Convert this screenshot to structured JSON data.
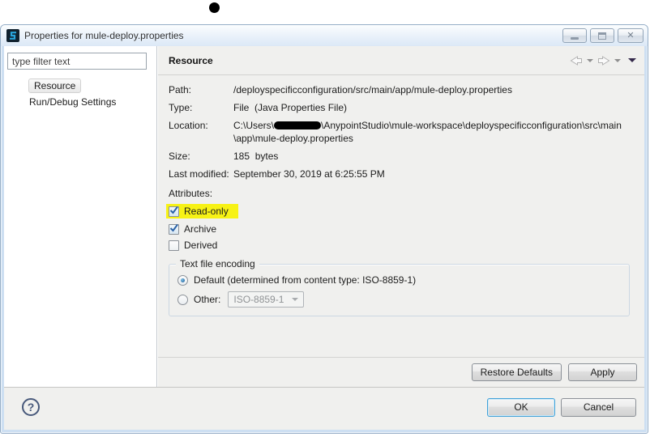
{
  "window": {
    "title": "Properties for mule-deploy.properties"
  },
  "sidebar": {
    "filter_placeholder": "type filter text",
    "items": [
      {
        "label": "Resource",
        "selected": true
      },
      {
        "label": "Run/Debug Settings",
        "selected": false
      }
    ]
  },
  "main": {
    "header": {
      "title": "Resource"
    },
    "fields": {
      "path": {
        "label": "Path:",
        "value": "/deployspecificconfiguration/src/main/app/mule-deploy.properties"
      },
      "type": {
        "label": "Type:",
        "value": "File  (Java Properties File)"
      },
      "location": {
        "label": "Location:",
        "prefix": "C:\\Users\\",
        "redacted": true,
        "line1_suffix": "\\AnypointStudio\\mule-workspace\\deployspecificconfiguration\\src\\main",
        "line2": "\\app\\mule-deploy.properties"
      },
      "size": {
        "label": "Size:",
        "value": "185  bytes"
      },
      "last_modified": {
        "label": "Last modified:",
        "value": "September 30, 2019 at 6:25:55 PM"
      }
    },
    "attributes": {
      "label": "Attributes:",
      "items": [
        {
          "label": "Read-only",
          "checked": true,
          "highlighted": true
        },
        {
          "label": "Archive",
          "checked": true,
          "highlighted": false
        },
        {
          "label": "Derived",
          "checked": false,
          "highlighted": false
        }
      ]
    },
    "encoding": {
      "group_label": "Text file encoding",
      "options": [
        {
          "label": "Default (determined from content type: ISO-8859-1)",
          "selected": true
        },
        {
          "label": "Other:",
          "selected": false,
          "value": "ISO-8859-1",
          "enabled": false
        }
      ]
    },
    "page_buttons": {
      "restore_defaults": "Restore Defaults",
      "apply": "Apply"
    }
  },
  "footer": {
    "help": "?",
    "ok": "OK",
    "cancel": "Cancel"
  },
  "colors": {
    "highlight_yellow": "#f7f215",
    "ok_focus_border": "#41a1d8",
    "window_frame": "#cddff2",
    "panel_bg": "#f0f0ee",
    "checkbox_check": "#2b62a7"
  }
}
